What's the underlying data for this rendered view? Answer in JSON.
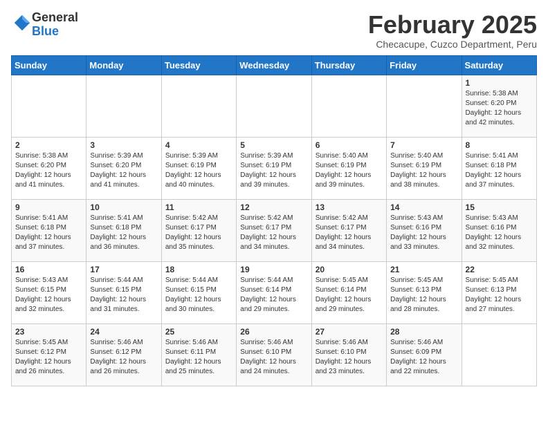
{
  "logo": {
    "general": "General",
    "blue": "Blue"
  },
  "header": {
    "month": "February 2025",
    "location": "Checacupe, Cuzco Department, Peru"
  },
  "weekdays": [
    "Sunday",
    "Monday",
    "Tuesday",
    "Wednesday",
    "Thursday",
    "Friday",
    "Saturday"
  ],
  "weeks": [
    [
      {
        "day": "",
        "info": ""
      },
      {
        "day": "",
        "info": ""
      },
      {
        "day": "",
        "info": ""
      },
      {
        "day": "",
        "info": ""
      },
      {
        "day": "",
        "info": ""
      },
      {
        "day": "",
        "info": ""
      },
      {
        "day": "1",
        "info": "Sunrise: 5:38 AM\nSunset: 6:20 PM\nDaylight: 12 hours and 42 minutes."
      }
    ],
    [
      {
        "day": "2",
        "info": "Sunrise: 5:38 AM\nSunset: 6:20 PM\nDaylight: 12 hours and 41 minutes."
      },
      {
        "day": "3",
        "info": "Sunrise: 5:39 AM\nSunset: 6:20 PM\nDaylight: 12 hours and 41 minutes."
      },
      {
        "day": "4",
        "info": "Sunrise: 5:39 AM\nSunset: 6:19 PM\nDaylight: 12 hours and 40 minutes."
      },
      {
        "day": "5",
        "info": "Sunrise: 5:39 AM\nSunset: 6:19 PM\nDaylight: 12 hours and 39 minutes."
      },
      {
        "day": "6",
        "info": "Sunrise: 5:40 AM\nSunset: 6:19 PM\nDaylight: 12 hours and 39 minutes."
      },
      {
        "day": "7",
        "info": "Sunrise: 5:40 AM\nSunset: 6:19 PM\nDaylight: 12 hours and 38 minutes."
      },
      {
        "day": "8",
        "info": "Sunrise: 5:41 AM\nSunset: 6:18 PM\nDaylight: 12 hours and 37 minutes."
      }
    ],
    [
      {
        "day": "9",
        "info": "Sunrise: 5:41 AM\nSunset: 6:18 PM\nDaylight: 12 hours and 37 minutes."
      },
      {
        "day": "10",
        "info": "Sunrise: 5:41 AM\nSunset: 6:18 PM\nDaylight: 12 hours and 36 minutes."
      },
      {
        "day": "11",
        "info": "Sunrise: 5:42 AM\nSunset: 6:17 PM\nDaylight: 12 hours and 35 minutes."
      },
      {
        "day": "12",
        "info": "Sunrise: 5:42 AM\nSunset: 6:17 PM\nDaylight: 12 hours and 34 minutes."
      },
      {
        "day": "13",
        "info": "Sunrise: 5:42 AM\nSunset: 6:17 PM\nDaylight: 12 hours and 34 minutes."
      },
      {
        "day": "14",
        "info": "Sunrise: 5:43 AM\nSunset: 6:16 PM\nDaylight: 12 hours and 33 minutes."
      },
      {
        "day": "15",
        "info": "Sunrise: 5:43 AM\nSunset: 6:16 PM\nDaylight: 12 hours and 32 minutes."
      }
    ],
    [
      {
        "day": "16",
        "info": "Sunrise: 5:43 AM\nSunset: 6:15 PM\nDaylight: 12 hours and 32 minutes."
      },
      {
        "day": "17",
        "info": "Sunrise: 5:44 AM\nSunset: 6:15 PM\nDaylight: 12 hours and 31 minutes."
      },
      {
        "day": "18",
        "info": "Sunrise: 5:44 AM\nSunset: 6:15 PM\nDaylight: 12 hours and 30 minutes."
      },
      {
        "day": "19",
        "info": "Sunrise: 5:44 AM\nSunset: 6:14 PM\nDaylight: 12 hours and 29 minutes."
      },
      {
        "day": "20",
        "info": "Sunrise: 5:45 AM\nSunset: 6:14 PM\nDaylight: 12 hours and 29 minutes."
      },
      {
        "day": "21",
        "info": "Sunrise: 5:45 AM\nSunset: 6:13 PM\nDaylight: 12 hours and 28 minutes."
      },
      {
        "day": "22",
        "info": "Sunrise: 5:45 AM\nSunset: 6:13 PM\nDaylight: 12 hours and 27 minutes."
      }
    ],
    [
      {
        "day": "23",
        "info": "Sunrise: 5:45 AM\nSunset: 6:12 PM\nDaylight: 12 hours and 26 minutes."
      },
      {
        "day": "24",
        "info": "Sunrise: 5:46 AM\nSunset: 6:12 PM\nDaylight: 12 hours and 26 minutes."
      },
      {
        "day": "25",
        "info": "Sunrise: 5:46 AM\nSunset: 6:11 PM\nDaylight: 12 hours and 25 minutes."
      },
      {
        "day": "26",
        "info": "Sunrise: 5:46 AM\nSunset: 6:10 PM\nDaylight: 12 hours and 24 minutes."
      },
      {
        "day": "27",
        "info": "Sunrise: 5:46 AM\nSunset: 6:10 PM\nDaylight: 12 hours and 23 minutes."
      },
      {
        "day": "28",
        "info": "Sunrise: 5:46 AM\nSunset: 6:09 PM\nDaylight: 12 hours and 22 minutes."
      },
      {
        "day": "",
        "info": ""
      }
    ]
  ]
}
